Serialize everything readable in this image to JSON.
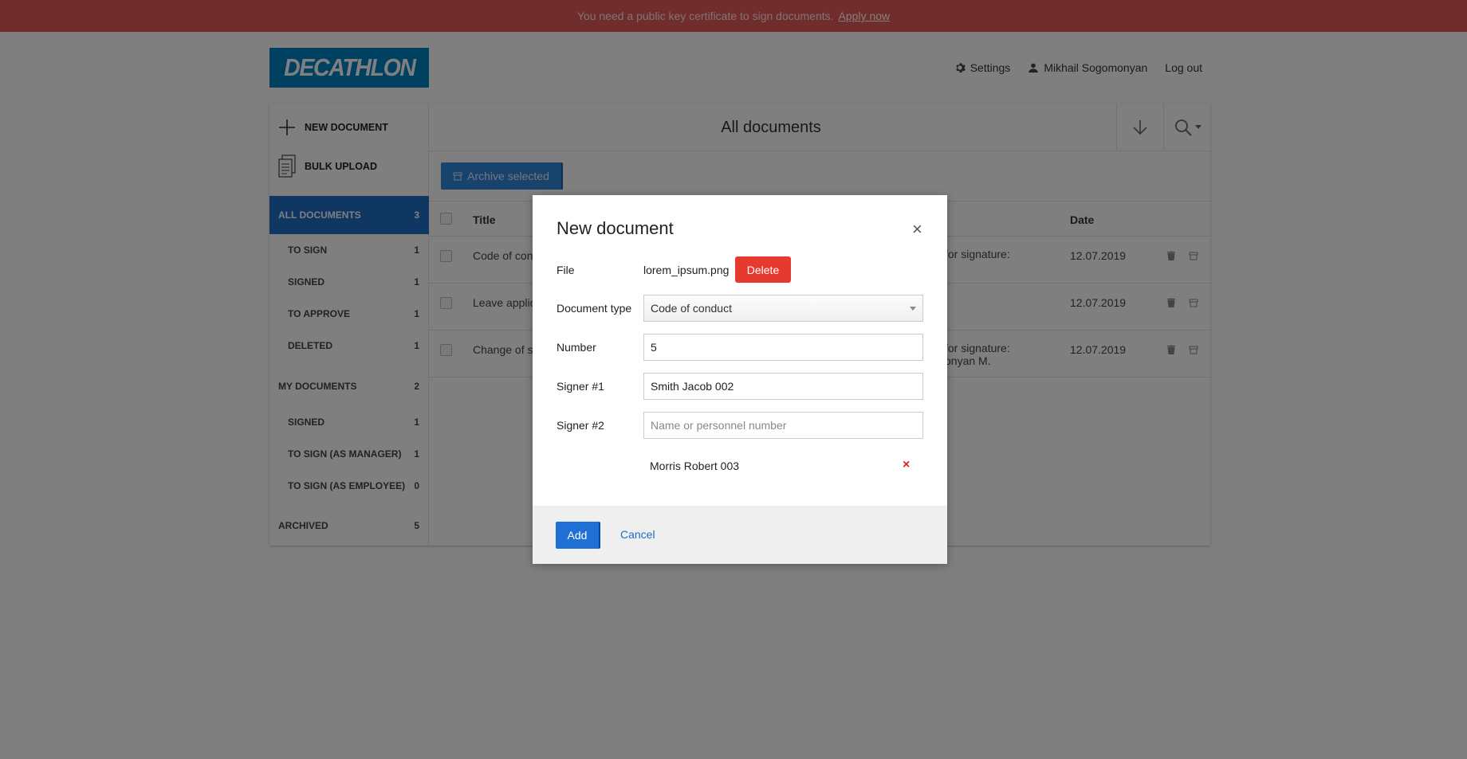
{
  "banner": {
    "text": "You need a public key certificate to sign documents.",
    "link": "Apply now"
  },
  "logo": {
    "text": "DECATHLON"
  },
  "topnav": {
    "settings": "Settings",
    "user": "Mikhail Sogomonyan",
    "logout": "Log out"
  },
  "sidebar": {
    "new_document": "NEW DOCUMENT",
    "bulk_upload": "BULK UPLOAD",
    "items": [
      {
        "label": "ALL DOCUMENTS",
        "count": "3"
      },
      {
        "label": "TO SIGN",
        "count": "1"
      },
      {
        "label": "SIGNED",
        "count": "1"
      },
      {
        "label": "TO APPROVE",
        "count": "1"
      },
      {
        "label": "DELETED",
        "count": "1"
      },
      {
        "label": "MY DOCUMENTS",
        "count": "2"
      },
      {
        "label": "SIGNED",
        "count": "1"
      },
      {
        "label": "TO SIGN (AS MANAGER)",
        "count": "1"
      },
      {
        "label": "TO SIGN (AS EMPLOYEE)",
        "count": "0"
      },
      {
        "label": "ARCHIVED",
        "count": "5"
      }
    ]
  },
  "main": {
    "title": "All documents",
    "archive_label": "Archive selected",
    "columns": {
      "title": "Title",
      "date": "Date"
    },
    "rows": [
      {
        "title": "Code of con",
        "status_line1": "for signature:",
        "status_line2": ".",
        "date": "12.07.2019"
      },
      {
        "title": "Leave applic",
        "status_line1": "",
        "status_line2": "",
        "date": "12.07.2019"
      },
      {
        "title": "Change of s",
        "status_line1": "for signature:",
        "status_line2": "onyan M.",
        "date": "12.07.2019"
      }
    ]
  },
  "modal": {
    "title": "New document",
    "close": "×",
    "file_label": "File",
    "file_name": "lorem_ipsum.png",
    "delete_label": "Delete",
    "doctype_label": "Document type",
    "doctype_value": "Code of conduct",
    "number_label": "Number",
    "number_value": "5",
    "signer1_label": "Signer #1",
    "signer1_value": "Smith Jacob 002",
    "signer2_label": "Signer #2",
    "signer2_placeholder": "Name or personnel number",
    "extra_signer": "Morris Robert 003",
    "remove_mark": "×",
    "add_label": "Add",
    "cancel_label": "Cancel"
  },
  "colors": {
    "banner": "#e35a58",
    "brand": "#0082c3",
    "accent": "#1f6fc5",
    "danger": "#e63a2e"
  },
  "icons": [
    "gear-icon",
    "user-icon",
    "plus-icon",
    "document-stack-icon",
    "archive-icon",
    "arrow-down-icon",
    "search-icon",
    "caret-down-icon",
    "trash-icon",
    "close-icon"
  ]
}
